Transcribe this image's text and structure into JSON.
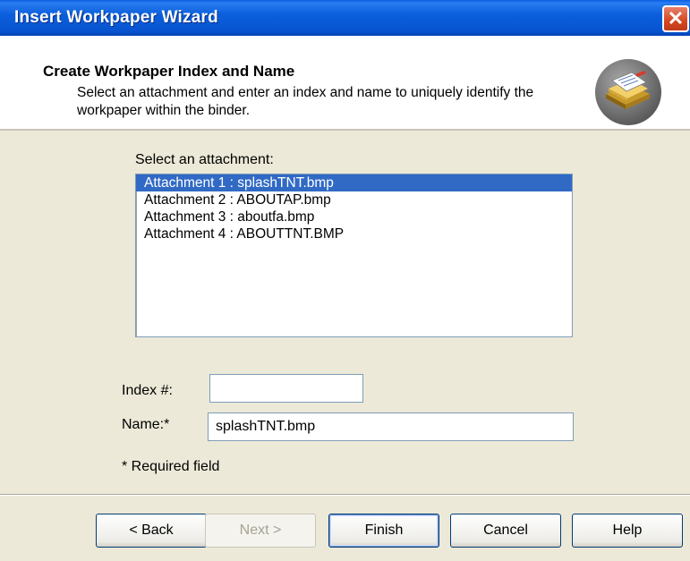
{
  "window": {
    "title": "Insert Workpaper Wizard",
    "close_label": "✕"
  },
  "header": {
    "title": "Create Workpaper Index and Name",
    "description": "Select an attachment and enter an index and name to uniquely identify the workpaper within the binder."
  },
  "attachments": {
    "label": "Select an attachment:",
    "items": [
      {
        "label": "Attachment 1 : splashTNT.bmp",
        "selected": true
      },
      {
        "label": "Attachment 2 : ABOUTAP.bmp",
        "selected": false
      },
      {
        "label": "Attachment 3 : aboutfa.bmp",
        "selected": false
      },
      {
        "label": "Attachment 4 : ABOUTTNT.BMP",
        "selected": false
      }
    ]
  },
  "form": {
    "index_label": "Index #:",
    "index_value": "",
    "name_label": "Name:*",
    "name_value": "splashTNT.bmp",
    "required_note": "* Required field"
  },
  "buttons": {
    "back": "< Back",
    "next": "Next >",
    "finish": "Finish",
    "cancel": "Cancel",
    "help": "Help"
  },
  "colors": {
    "title_bar": "#0a5ee0",
    "selection": "#316ac5",
    "dialog_bg": "#ece9d8"
  },
  "icons": {
    "header": "workpaper-stack-icon",
    "close": "close-icon"
  }
}
